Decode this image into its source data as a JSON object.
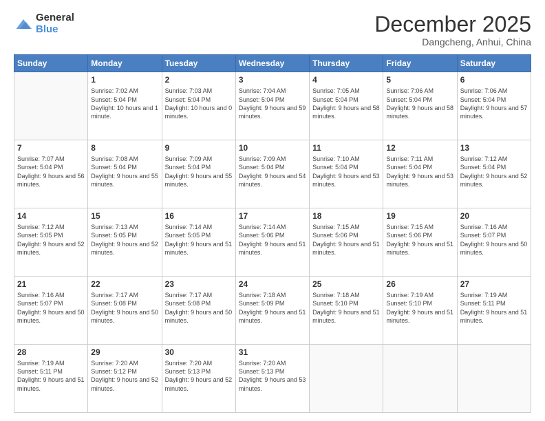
{
  "header": {
    "logo_general": "General",
    "logo_blue": "Blue",
    "month": "December 2025",
    "location": "Dangcheng, Anhui, China"
  },
  "weekdays": [
    "Sunday",
    "Monday",
    "Tuesday",
    "Wednesday",
    "Thursday",
    "Friday",
    "Saturday"
  ],
  "weeks": [
    [
      {
        "day": "",
        "sunrise": "",
        "sunset": "",
        "daylight": ""
      },
      {
        "day": "1",
        "sunrise": "7:02 AM",
        "sunset": "5:04 PM",
        "daylight": "10 hours and 1 minute."
      },
      {
        "day": "2",
        "sunrise": "7:03 AM",
        "sunset": "5:04 PM",
        "daylight": "10 hours and 0 minutes."
      },
      {
        "day": "3",
        "sunrise": "7:04 AM",
        "sunset": "5:04 PM",
        "daylight": "9 hours and 59 minutes."
      },
      {
        "day": "4",
        "sunrise": "7:05 AM",
        "sunset": "5:04 PM",
        "daylight": "9 hours and 58 minutes."
      },
      {
        "day": "5",
        "sunrise": "7:06 AM",
        "sunset": "5:04 PM",
        "daylight": "9 hours and 58 minutes."
      },
      {
        "day": "6",
        "sunrise": "7:06 AM",
        "sunset": "5:04 PM",
        "daylight": "9 hours and 57 minutes."
      }
    ],
    [
      {
        "day": "7",
        "sunrise": "7:07 AM",
        "sunset": "5:04 PM",
        "daylight": "9 hours and 56 minutes."
      },
      {
        "day": "8",
        "sunrise": "7:08 AM",
        "sunset": "5:04 PM",
        "daylight": "9 hours and 55 minutes."
      },
      {
        "day": "9",
        "sunrise": "7:09 AM",
        "sunset": "5:04 PM",
        "daylight": "9 hours and 55 minutes."
      },
      {
        "day": "10",
        "sunrise": "7:09 AM",
        "sunset": "5:04 PM",
        "daylight": "9 hours and 54 minutes."
      },
      {
        "day": "11",
        "sunrise": "7:10 AM",
        "sunset": "5:04 PM",
        "daylight": "9 hours and 53 minutes."
      },
      {
        "day": "12",
        "sunrise": "7:11 AM",
        "sunset": "5:04 PM",
        "daylight": "9 hours and 53 minutes."
      },
      {
        "day": "13",
        "sunrise": "7:12 AM",
        "sunset": "5:04 PM",
        "daylight": "9 hours and 52 minutes."
      }
    ],
    [
      {
        "day": "14",
        "sunrise": "7:12 AM",
        "sunset": "5:05 PM",
        "daylight": "9 hours and 52 minutes."
      },
      {
        "day": "15",
        "sunrise": "7:13 AM",
        "sunset": "5:05 PM",
        "daylight": "9 hours and 52 minutes."
      },
      {
        "day": "16",
        "sunrise": "7:14 AM",
        "sunset": "5:05 PM",
        "daylight": "9 hours and 51 minutes."
      },
      {
        "day": "17",
        "sunrise": "7:14 AM",
        "sunset": "5:06 PM",
        "daylight": "9 hours and 51 minutes."
      },
      {
        "day": "18",
        "sunrise": "7:15 AM",
        "sunset": "5:06 PM",
        "daylight": "9 hours and 51 minutes."
      },
      {
        "day": "19",
        "sunrise": "7:15 AM",
        "sunset": "5:06 PM",
        "daylight": "9 hours and 51 minutes."
      },
      {
        "day": "20",
        "sunrise": "7:16 AM",
        "sunset": "5:07 PM",
        "daylight": "9 hours and 50 minutes."
      }
    ],
    [
      {
        "day": "21",
        "sunrise": "7:16 AM",
        "sunset": "5:07 PM",
        "daylight": "9 hours and 50 minutes."
      },
      {
        "day": "22",
        "sunrise": "7:17 AM",
        "sunset": "5:08 PM",
        "daylight": "9 hours and 50 minutes."
      },
      {
        "day": "23",
        "sunrise": "7:17 AM",
        "sunset": "5:08 PM",
        "daylight": "9 hours and 50 minutes."
      },
      {
        "day": "24",
        "sunrise": "7:18 AM",
        "sunset": "5:09 PM",
        "daylight": "9 hours and 51 minutes."
      },
      {
        "day": "25",
        "sunrise": "7:18 AM",
        "sunset": "5:10 PM",
        "daylight": "9 hours and 51 minutes."
      },
      {
        "day": "26",
        "sunrise": "7:19 AM",
        "sunset": "5:10 PM",
        "daylight": "9 hours and 51 minutes."
      },
      {
        "day": "27",
        "sunrise": "7:19 AM",
        "sunset": "5:11 PM",
        "daylight": "9 hours and 51 minutes."
      }
    ],
    [
      {
        "day": "28",
        "sunrise": "7:19 AM",
        "sunset": "5:11 PM",
        "daylight": "9 hours and 51 minutes."
      },
      {
        "day": "29",
        "sunrise": "7:20 AM",
        "sunset": "5:12 PM",
        "daylight": "9 hours and 52 minutes."
      },
      {
        "day": "30",
        "sunrise": "7:20 AM",
        "sunset": "5:13 PM",
        "daylight": "9 hours and 52 minutes."
      },
      {
        "day": "31",
        "sunrise": "7:20 AM",
        "sunset": "5:13 PM",
        "daylight": "9 hours and 53 minutes."
      },
      {
        "day": "",
        "sunrise": "",
        "sunset": "",
        "daylight": ""
      },
      {
        "day": "",
        "sunrise": "",
        "sunset": "",
        "daylight": ""
      },
      {
        "day": "",
        "sunrise": "",
        "sunset": "",
        "daylight": ""
      }
    ]
  ],
  "labels": {
    "sunrise_prefix": "Sunrise: ",
    "sunset_prefix": "Sunset: ",
    "daylight_prefix": "Daylight hours"
  }
}
